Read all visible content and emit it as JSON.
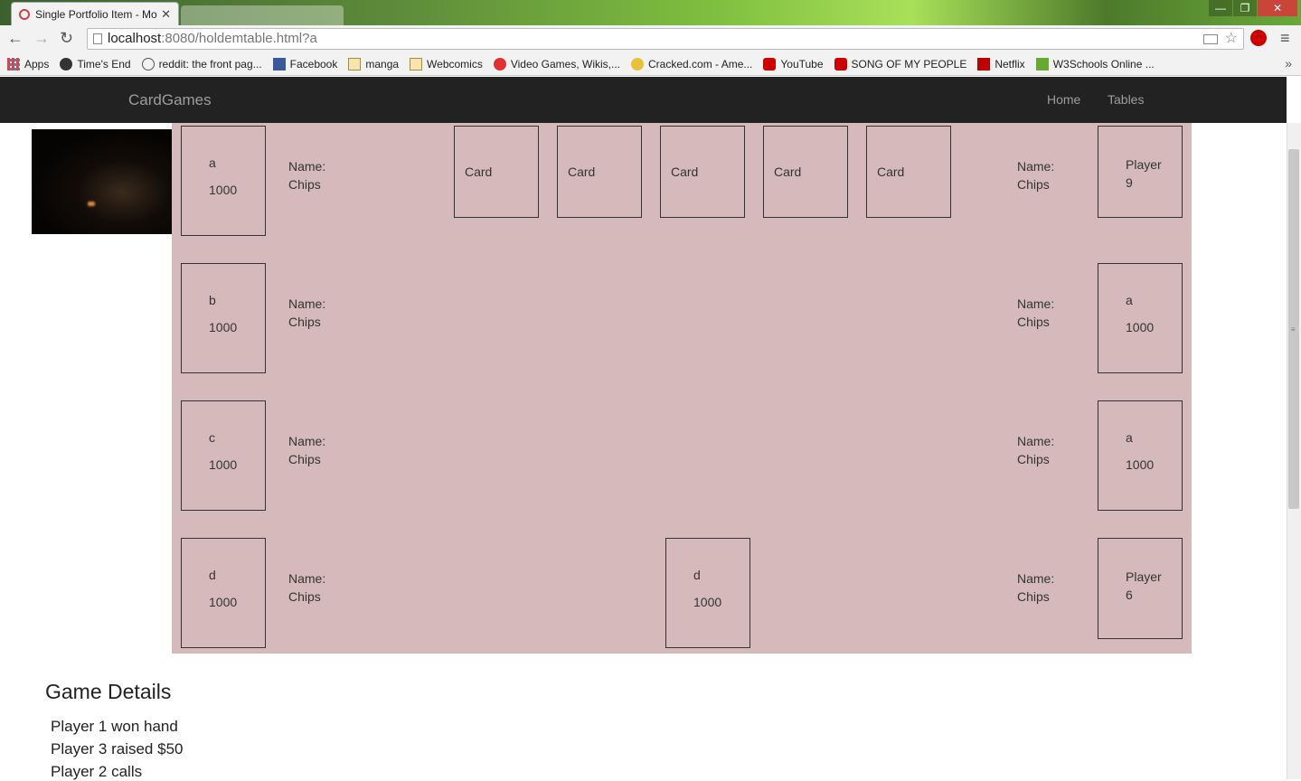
{
  "browser": {
    "tab_title": "Single Portfolio Item - Mo",
    "url_host": "localhost",
    "url_path": ":8080/holdemtable.html?a",
    "bookmarks": [
      "Apps",
      "Time's End",
      "reddit: the front pag...",
      "Facebook",
      "manga",
      "Webcomics",
      "Video Games, Wikis,...",
      "Cracked.com - Ame...",
      "YouTube",
      "SONG OF MY PEOPLE",
      "Netflix",
      "W3Schools Online ..."
    ],
    "more": "»"
  },
  "navbar": {
    "brand": "CardGames",
    "links": [
      "Home",
      "Tables"
    ]
  },
  "seats": {
    "s1": {
      "name": "a",
      "chips": "1000"
    },
    "s2": {
      "name": "b",
      "chips": "1000"
    },
    "s3": {
      "name": "c",
      "chips": "1000"
    },
    "s4": {
      "name": "d",
      "chips": "1000"
    },
    "s5": {
      "name": "d",
      "chips": "1000"
    },
    "s6": {
      "name": "Player 6",
      "chips": ""
    },
    "s7": {
      "name": "a",
      "chips": "1000"
    },
    "s8": {
      "name": "a",
      "chips": "1000"
    },
    "s9": {
      "name": "Player 9",
      "chips": ""
    }
  },
  "info": {
    "name_label": "Name:",
    "chips_label": "Chips"
  },
  "cards": [
    "Card",
    "Card",
    "Card",
    "Card",
    "Card"
  ],
  "details": {
    "title": "Game Details",
    "log": [
      "Player 1 won hand",
      "Player 3 raised $50",
      "Player 2 calls"
    ]
  }
}
